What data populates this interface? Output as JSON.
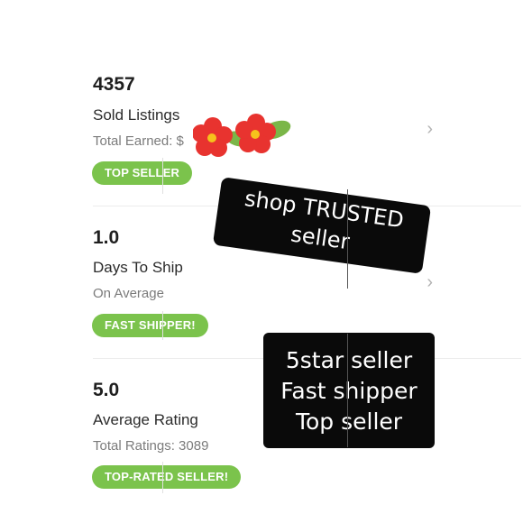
{
  "stats": [
    {
      "value": "4357",
      "label": "Sold Listings",
      "sub": "Total Earned: $",
      "badge": "TOP SELLER"
    },
    {
      "value": "1.0",
      "label": "Days To Ship",
      "sub": "On Average",
      "badge": "FAST SHIPPER!"
    },
    {
      "value": "5.0",
      "label": "Average Rating",
      "sub": "Total Ratings: 3089",
      "badge": "TOP-RATED SELLER!"
    }
  ],
  "chevron": "›",
  "stickers": {
    "trusted": [
      "shop TRUSTED",
      "seller"
    ],
    "seller_info": [
      "5star seller",
      "Fast shipper",
      "Top seller"
    ]
  },
  "colors": {
    "badge": "#7bc34c",
    "flower": "#e8332f",
    "leaf": "#7ab648",
    "sticker": "#0a0a0a"
  },
  "icons": [
    "flower-icon",
    "leaf-icon",
    "chevron-right-icon"
  ]
}
